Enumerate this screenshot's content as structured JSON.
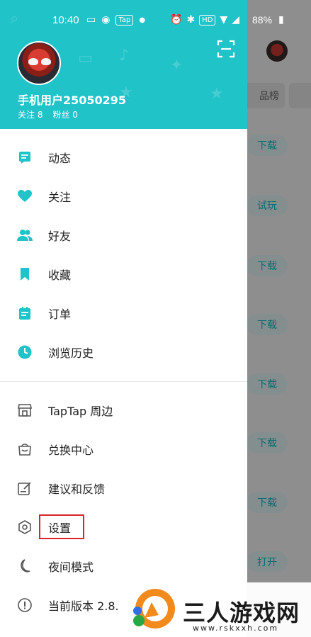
{
  "status_bar": {
    "time": "10:40",
    "tap_badge": "Tap",
    "hd_badge": "HD",
    "battery": "88%"
  },
  "drawer": {
    "username": "手机用户25050295",
    "following": "关注 8",
    "followers": "粉丝 0",
    "menu_primary": [
      {
        "label": "动态",
        "icon": "feed-icon"
      },
      {
        "label": "关注",
        "icon": "heart-icon"
      },
      {
        "label": "好友",
        "icon": "friends-icon"
      },
      {
        "label": "收藏",
        "icon": "bookmark-icon"
      },
      {
        "label": "订单",
        "icon": "order-icon"
      },
      {
        "label": "浏览历史",
        "icon": "clock-icon"
      }
    ],
    "menu_secondary": [
      {
        "label": "TapTap 周边",
        "icon": "shop-icon"
      },
      {
        "label": "兑换中心",
        "icon": "bag-icon"
      },
      {
        "label": "建议和反馈",
        "icon": "feedback-icon"
      },
      {
        "label": "设置",
        "icon": "settings-icon"
      },
      {
        "label": "夜间模式",
        "icon": "moon-icon"
      },
      {
        "label": "当前版本 2.8.",
        "icon": "info-icon"
      }
    ]
  },
  "background": {
    "tab_label": "品榜",
    "buttons": [
      "下载",
      "试玩",
      "下载",
      "下载",
      "下载",
      "下载",
      "下载",
      "打开"
    ]
  },
  "watermark": {
    "title": "三人游戏网",
    "url": "www.rskxxh.com"
  },
  "colors": {
    "accent": "#1fc3c8",
    "highlight_box": "#d8262b"
  }
}
